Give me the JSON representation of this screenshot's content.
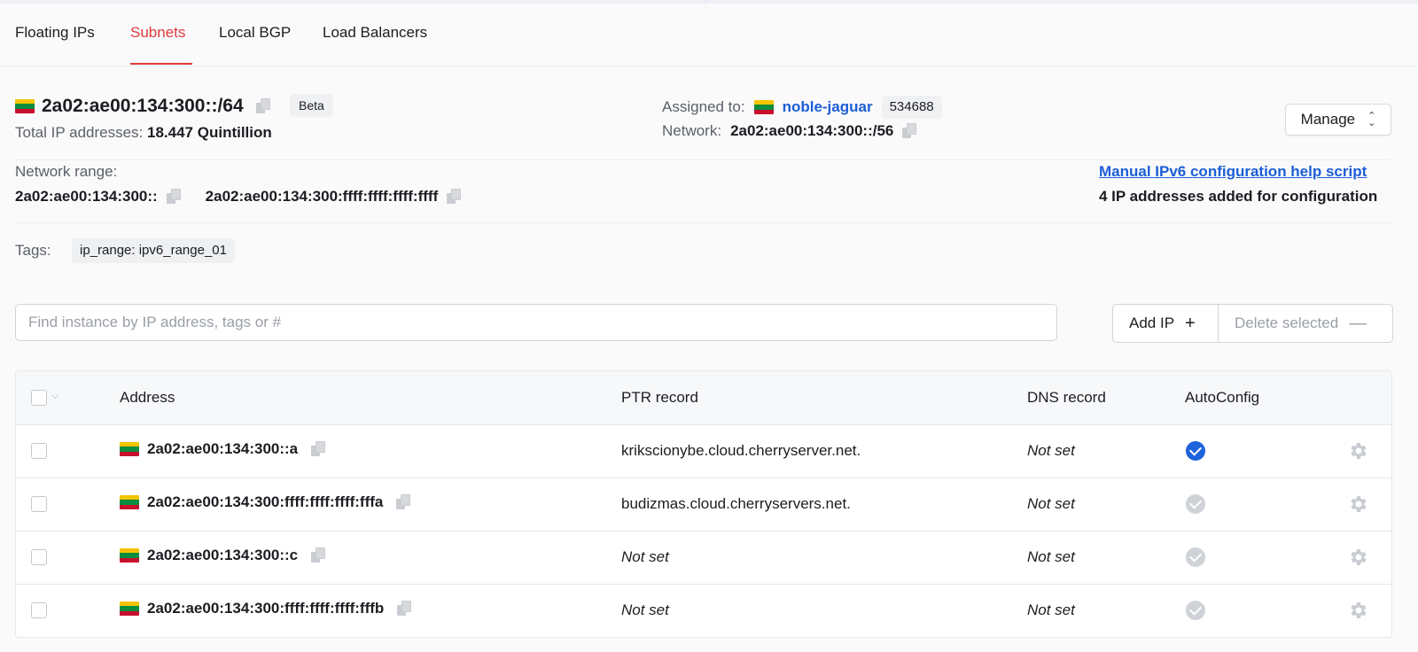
{
  "tabs": [
    {
      "label": "Floating IPs"
    },
    {
      "label": "Subnets",
      "active": true
    },
    {
      "label": "Local BGP"
    },
    {
      "label": "Load Balancers"
    }
  ],
  "subnet": {
    "cidr": "2a02:ae00:134:300::/64",
    "badge": "Beta",
    "total_label": "Total IP addresses:",
    "total_value": "18.447 Quintillion",
    "country_flag": "lithuania-flag"
  },
  "assignment": {
    "assigned_label": "Assigned to:",
    "server_name": "noble-jaguar",
    "server_id": "534688",
    "network_label": "Network:",
    "network_value": "2a02:ae00:134:300::/56"
  },
  "manage_label": "Manage",
  "range": {
    "label": "Network range:",
    "start": "2a02:ae00:134:300::",
    "end": "2a02:ae00:134:300:ffff:ffff:ffff:ffff"
  },
  "help_link": "Manual IPv6 configuration help script",
  "config_note": "4 IP addresses added for configuration",
  "tags": {
    "label": "Tags:",
    "items": [
      "ip_range: ipv6_range_01"
    ]
  },
  "search": {
    "placeholder": "Find instance by IP address, tags or #",
    "value": ""
  },
  "actions": {
    "add_label": "Add IP",
    "delete_label": "Delete selected"
  },
  "table": {
    "columns": [
      "Address",
      "PTR record",
      "DNS record",
      "AutoConfig"
    ],
    "rows": [
      {
        "address": "2a02:ae00:134:300::a",
        "ptr": "krikscionybe.cloud.cherryserver.net.",
        "ptr_set": true,
        "dns": "Not set",
        "autoconfig": true
      },
      {
        "address": "2a02:ae00:134:300:ffff:ffff:ffff:fffa",
        "ptr": "budizmas.cloud.cherryservers.net.",
        "ptr_set": true,
        "dns": "Not set",
        "autoconfig": false
      },
      {
        "address": "2a02:ae00:134:300::c",
        "ptr": "Not set",
        "ptr_set": false,
        "dns": "Not set",
        "autoconfig": false
      },
      {
        "address": "2a02:ae00:134:300:ffff:ffff:ffff:fffb",
        "ptr": "Not set",
        "ptr_set": false,
        "dns": "Not set",
        "autoconfig": false
      }
    ]
  },
  "colors": {
    "accent_red": "#e03b3b",
    "link_blue": "#1c5ed6",
    "autoconfig_on": "#1e63dc"
  }
}
